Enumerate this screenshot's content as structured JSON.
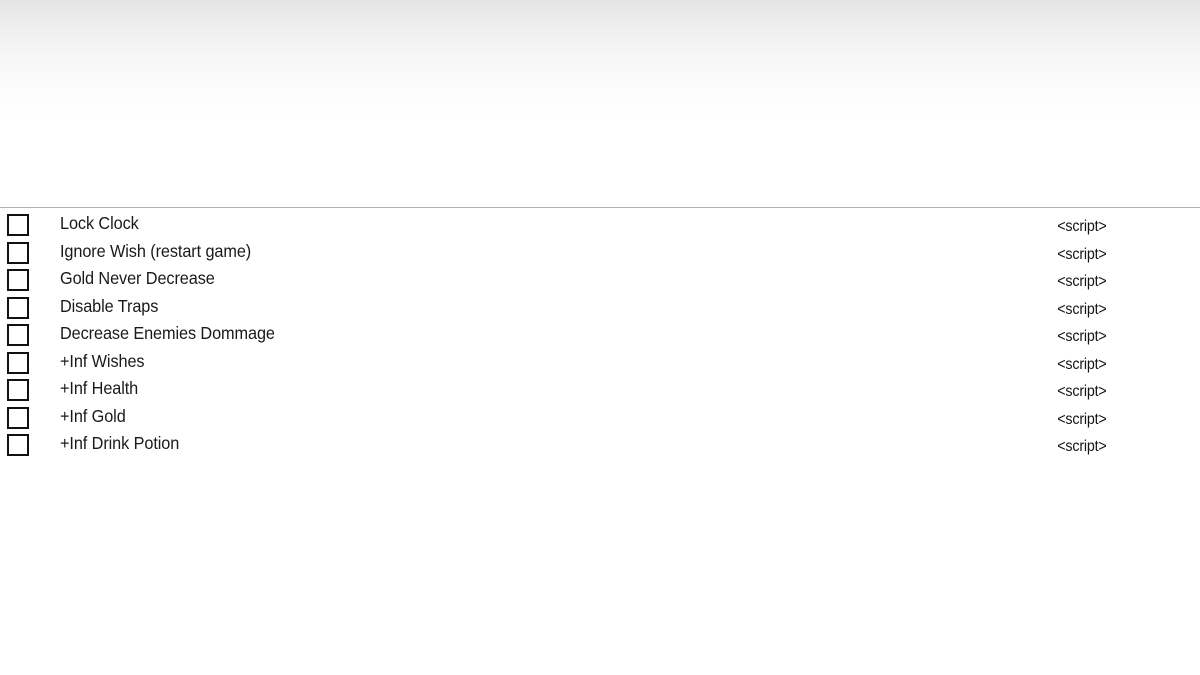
{
  "page": {
    "background_color": "#ffffff",
    "gradient_top_color": "#e4e4e4",
    "gradient_bottom_color": "#ffffff",
    "separator_color": "#b3b3b3",
    "text_color": "#1a1a1a",
    "checkbox_border_color": "#111111"
  },
  "cheat_list": {
    "script_link_label": "<script>",
    "items": [
      {
        "label": "Lock Clock",
        "script": "<script>",
        "checked": false
      },
      {
        "label": "Ignore Wish (restart game)",
        "script": "<script>",
        "checked": false
      },
      {
        "label": "Gold Never Decrease",
        "script": "<script>",
        "checked": false
      },
      {
        "label": "Disable Traps",
        "script": "<script>",
        "checked": false
      },
      {
        "label": "Decrease Enemies Dommage",
        "script": "<script>",
        "checked": false
      },
      {
        "label": "+Inf Wishes",
        "script": "<script>",
        "checked": false
      },
      {
        "label": "+Inf Health",
        "script": "<script>",
        "checked": false
      },
      {
        "label": "+Inf Gold",
        "script": "<script>",
        "checked": false
      },
      {
        "label": "+Inf Drink Potion",
        "script": "<script>",
        "checked": false
      }
    ]
  }
}
